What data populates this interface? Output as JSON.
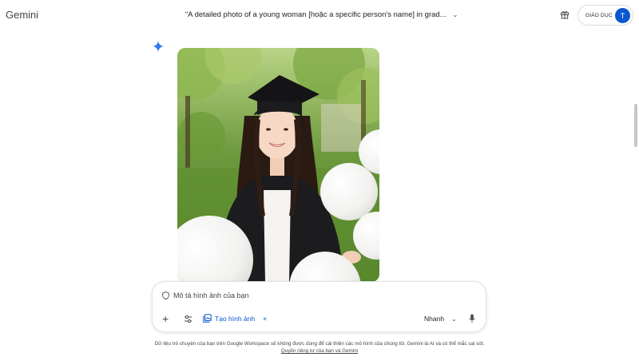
{
  "app": {
    "brand": "Gemini"
  },
  "header": {
    "conversation_title": "“A detailed photo of a young woman [hoặc a specific person's name] in grad...",
    "chevron_icon": "chevron-down-icon",
    "gift_icon": "gift-icon",
    "account_label": "GIÁO DỤC",
    "avatar_initial": "T",
    "avatar_color": "#0b57d0"
  },
  "response": {
    "icon": "gemini-spark-icon",
    "image_subject": "graduation photo"
  },
  "prompt": {
    "placeholder": "Mô tả hình ảnh của bạn",
    "add_icon": "plus-icon",
    "tools_icon": "tools-icon",
    "chip_label": "Tạo hình ảnh",
    "chip_icon": "image-gallery-icon",
    "chip_close": "×",
    "model_label": "Nhanh",
    "mic_icon": "microphone-icon"
  },
  "footer": {
    "disclaimer": "Dữ liệu trò chuyện của bạn trên Google Workspace sẽ không được dùng để cải thiện các mô hình của chúng tôi. Gemini là AI và có thể mắc sai sót.",
    "privacy_link": "Quyền riêng tư của bạn và Gemini"
  },
  "colors": {
    "accent": "#0b57d0",
    "text": "#1f1f1f",
    "muted": "#444746"
  }
}
